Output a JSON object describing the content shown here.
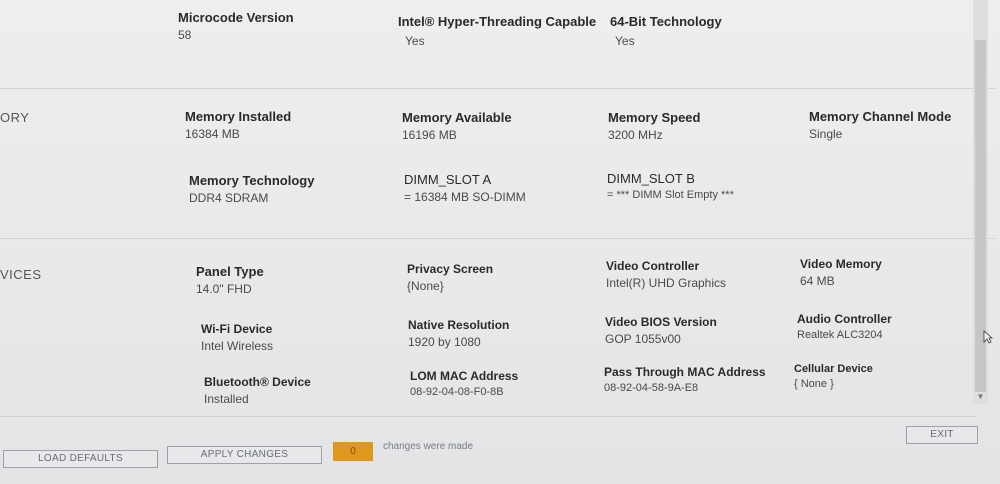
{
  "top_row": {
    "microcode": {
      "label": "Microcode Version",
      "value": "58"
    },
    "hyperthreading": {
      "label": "Intel® Hyper-Threading Capable",
      "value": "Yes"
    },
    "bit64": {
      "label": "64-Bit Technology",
      "value": "Yes"
    }
  },
  "memory": {
    "section_label": "ORY",
    "installed": {
      "label": "Memory Installed",
      "value": "16384 MB"
    },
    "available": {
      "label": "Memory Available",
      "value": "16196 MB"
    },
    "speed": {
      "label": "Memory Speed",
      "value": "3200 MHz"
    },
    "channel_mode": {
      "label": "Memory Channel Mode",
      "value": "Single"
    },
    "technology": {
      "label": "Memory Technology",
      "value": "DDR4 SDRAM"
    },
    "dimm_a": {
      "label": "DIMM_SLOT A",
      "value": "= 16384 MB SO-DIMM"
    },
    "dimm_b": {
      "label": "DIMM_SLOT B",
      "value": "= *** DIMM Slot Empty ***"
    }
  },
  "devices": {
    "section_label": "VICES",
    "panel_type": {
      "label": "Panel Type",
      "value": "14.0\" FHD"
    },
    "privacy_screen": {
      "label": "Privacy Screen",
      "value": "{None}"
    },
    "video_controller": {
      "label": "Video Controller",
      "value": "Intel(R) UHD Graphics"
    },
    "video_memory": {
      "label": "Video Memory",
      "value": "64 MB"
    },
    "wifi": {
      "label": "Wi-Fi Device",
      "value": "Intel Wireless"
    },
    "native_resolution": {
      "label": "Native Resolution",
      "value": "1920 by 1080"
    },
    "video_bios": {
      "label": "Video BIOS Version",
      "value": "GOP 1055v00"
    },
    "audio": {
      "label": "Audio Controller",
      "value": "Realtek ALC3204"
    },
    "bluetooth": {
      "label": "Bluetooth® Device",
      "value": "Installed"
    },
    "lom_mac": {
      "label": "LOM MAC Address",
      "value": "08-92-04-08-F0-8B"
    },
    "passthrough_mac": {
      "label": "Pass Through MAC Address",
      "value": "08-92-04-58-9A-E8"
    },
    "cellular": {
      "label": "Cellular Device",
      "value": "{ None }"
    }
  },
  "footer": {
    "load_defaults": "LOAD DEFAULTS",
    "apply_changes": "APPLY CHANGES",
    "change_count": "0",
    "changes_text": "changes were made",
    "exit": "EXIT"
  },
  "scrollbar": {
    "down_arrow": "▼"
  },
  "icons": {
    "cursor": "mouse-cursor-icon"
  }
}
